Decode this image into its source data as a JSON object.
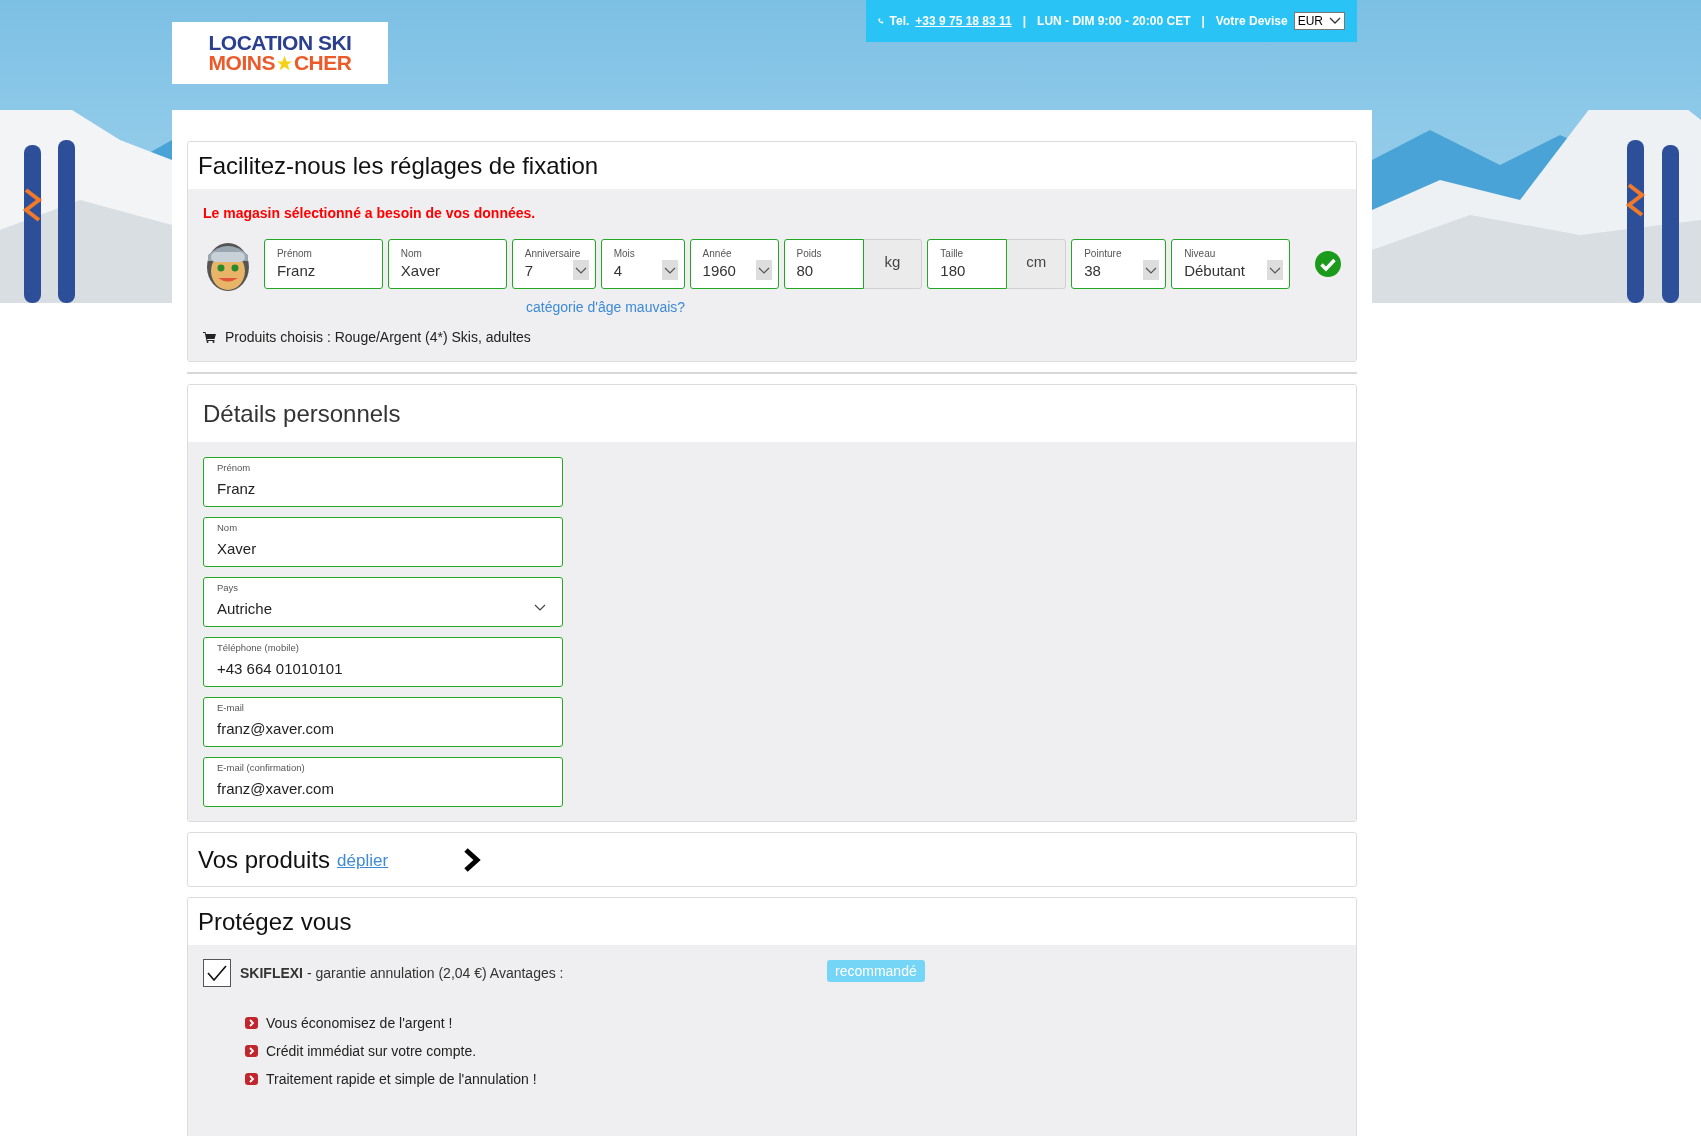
{
  "header": {
    "logo": {
      "line_1": "LOCATION SKI",
      "line_2_left": "MOINS",
      "line_2_right": "CHER"
    },
    "contact": [
      {
        "kind": "phone",
        "label": "Tel.",
        "value": "+33 9 75 18 83 11"
      },
      {
        "kind": "separator",
        "text": "|"
      },
      {
        "kind": "text",
        "text": "LUN - DIM 9:00 - 20:00 CET"
      },
      {
        "kind": "separator",
        "text": "|"
      },
      {
        "kind": "currency",
        "label": "Votre Devise",
        "value": "EUR"
      }
    ]
  },
  "fixation": {
    "title": "Facilitez-nous les réglages de fixation",
    "alert": "Le magasin sélectionné a besoin de vos données.",
    "fields": [
      {
        "kind": "text",
        "label": "Prénom",
        "value": "Franz"
      },
      {
        "kind": "text",
        "label": "Nom",
        "value": "Xaver"
      },
      {
        "kind": "select",
        "label": "Anniversaire",
        "value": "7"
      },
      {
        "kind": "select",
        "label": "Mois",
        "value": "4"
      },
      {
        "kind": "select",
        "label": "Année",
        "value": "1960"
      },
      {
        "kind": "unit",
        "label": "Poids",
        "value": "80",
        "unit": "kg"
      },
      {
        "kind": "unit",
        "label": "Taille",
        "value": "180",
        "unit": "cm"
      },
      {
        "kind": "select",
        "label": "Pointure",
        "value": "38"
      },
      {
        "kind": "select",
        "label": "Niveau",
        "value": "Débutant"
      }
    ],
    "valid": true,
    "age_link": "catégorie d'âge mauvais?",
    "products": "Produits choisis : Rouge/Argent (4*) Skis, adultes"
  },
  "personal": {
    "title": "Détails personnels",
    "fields": [
      {
        "kind": "text",
        "label": "Prénom",
        "value": "Franz"
      },
      {
        "kind": "text",
        "label": "Nom",
        "value": "Xaver"
      },
      {
        "kind": "select",
        "label": "Pays",
        "value": "Autriche"
      },
      {
        "kind": "text",
        "label": "Téléphone (mobile)",
        "value": "+43 664 01010101"
      },
      {
        "kind": "text",
        "label": "E-mail",
        "value": "franz@xaver.com"
      },
      {
        "kind": "text",
        "label": "E-mail (confirmation)",
        "value": "franz@xaver.com"
      }
    ]
  },
  "products": {
    "title": "Vos produits",
    "link": "déplier"
  },
  "protect": {
    "title": "Protégez vous",
    "option": {
      "checked": true,
      "label": "**SKIFLEXI** - garantie annulation (2,04 €) Avantages :",
      "badge": "recommandé"
    },
    "benefits": [
      "Vous économisez de l'argent !",
      "Crédit immédiat sur votre compte.",
      "Traitement rapide et simple de l'annulation !"
    ]
  }
}
